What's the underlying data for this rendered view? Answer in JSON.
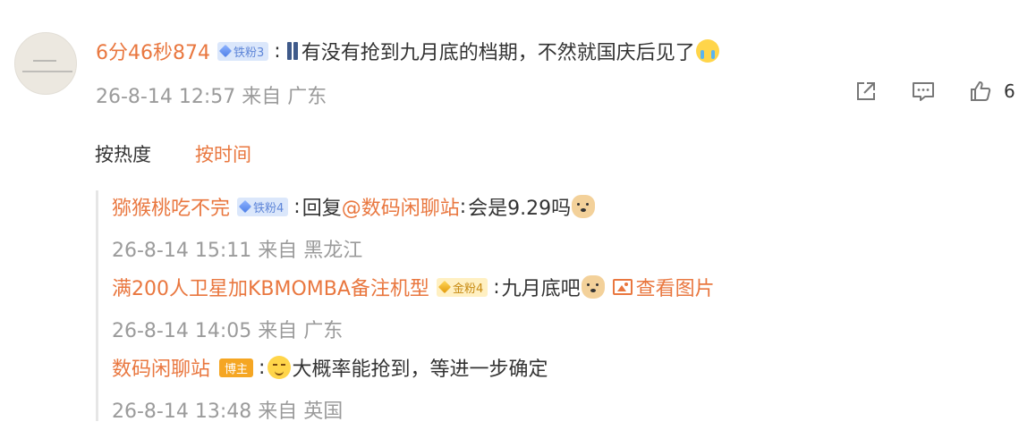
{
  "colors": {
    "accent": "#e9773f",
    "meta": "#9b9b9b",
    "text": "#333333",
    "badge_blue": "#5f86d8",
    "badge_gold": "#c78a12",
    "host_badge": "#f5a623"
  },
  "comment": {
    "username": "6分46秒874",
    "badge": "铁粉3",
    "colon": ":",
    "text": "有没有抢到九月底的档期，不然就国庆后见了",
    "emoji_lead": "pants-emoji",
    "emoji_tail": "crying-emoji",
    "time": "26-8-14 12:57",
    "location": "来自 广东",
    "like_count": "6",
    "actions": [
      "share-icon",
      "comment-icon",
      "like-icon"
    ]
  },
  "sort": {
    "hot": "按热度",
    "time": "按时间",
    "active": "time"
  },
  "replies": [
    {
      "username": "猕猴桃吃不完",
      "badge": "铁粉4",
      "colon": ":",
      "prefix": "回复",
      "mention": "@数码闲聊站",
      "colon2": ":",
      "text": "会是9.29吗",
      "emoji": "doge-emoji",
      "time": "26-8-14 15:11",
      "location": "来自 黑龙江"
    },
    {
      "username": "满200人卫星加KBMOMBA备注机型",
      "badge": "金粉4",
      "colon": ":",
      "text": "九月底吧",
      "emoji": "doge-emoji",
      "view_pic": "查看图片",
      "time": "26-8-14 14:05",
      "location": "来自 广东"
    },
    {
      "username": "数码闲聊站",
      "badge": "博主",
      "colon": ":",
      "emoji": "smile-emoji",
      "text": "大概率能抢到，等进一步确定",
      "time": "26-8-14 13:48",
      "location": "来自 英国"
    }
  ]
}
